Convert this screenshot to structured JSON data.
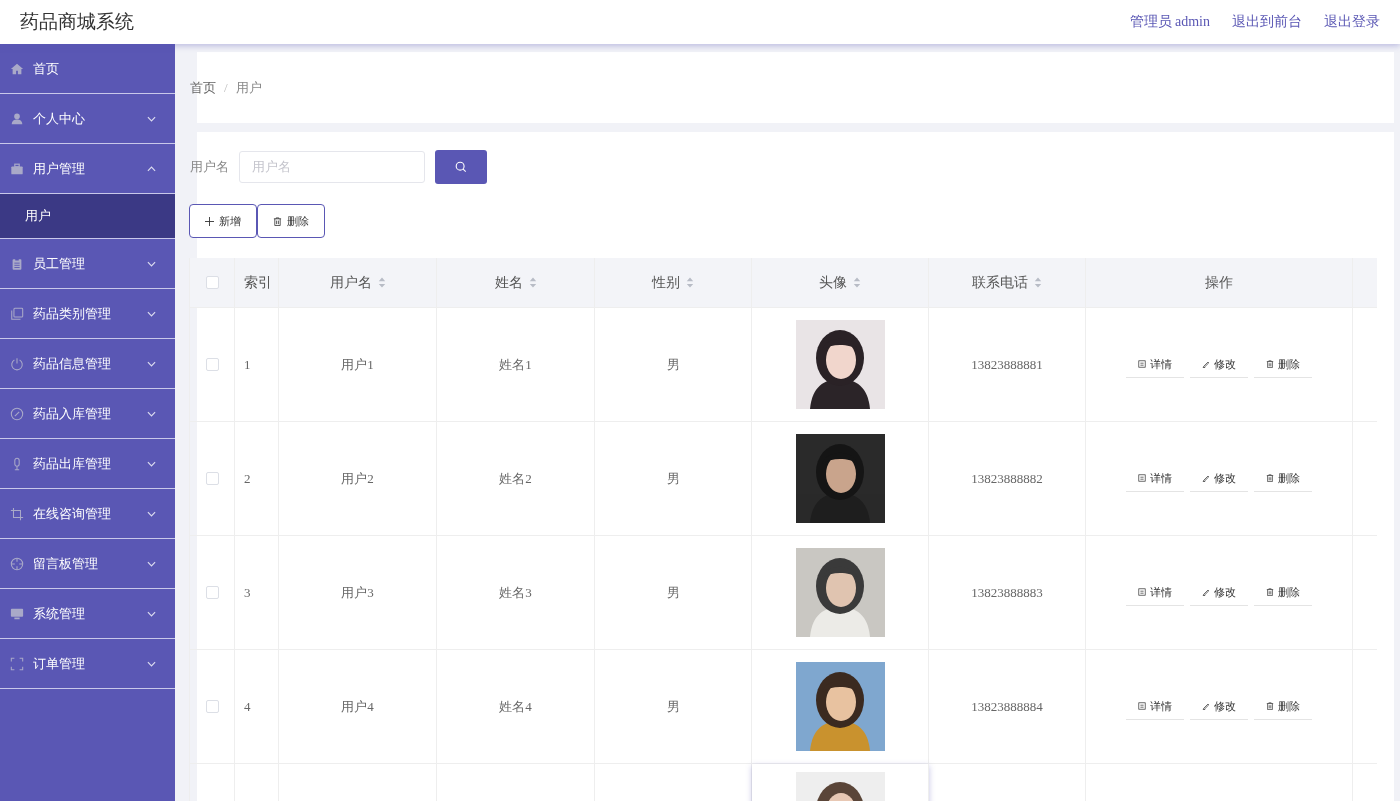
{
  "header": {
    "title": "药品商城系统",
    "links": [
      "管理员 admin",
      "退出到前台",
      "退出登录"
    ]
  },
  "sidebar": {
    "items": [
      {
        "label": "首页"
      },
      {
        "label": "个人中心",
        "expanded": false
      },
      {
        "label": "用户管理",
        "expanded": true,
        "children": [
          {
            "label": "用户",
            "selected": true
          }
        ]
      },
      {
        "label": "员工管理",
        "expanded": false
      },
      {
        "label": "药品类别管理",
        "expanded": false
      },
      {
        "label": "药品信息管理",
        "expanded": false
      },
      {
        "label": "药品入库管理",
        "expanded": false
      },
      {
        "label": "药品出库管理",
        "expanded": false
      },
      {
        "label": "在线咨询管理",
        "expanded": false
      },
      {
        "label": "留言板管理",
        "expanded": false
      },
      {
        "label": "系统管理",
        "expanded": false
      },
      {
        "label": "订单管理",
        "expanded": false
      }
    ]
  },
  "breadcrumb": [
    "首页",
    "/",
    "用户"
  ],
  "search": {
    "label": "用户名",
    "placeholder": "用户名"
  },
  "actions": [
    {
      "kind": "add",
      "label": "新增"
    },
    {
      "kind": "delete",
      "label": "删除"
    }
  ],
  "table": {
    "header_checked": false,
    "columns": [
      {
        "label": "索引",
        "sortable": false
      },
      {
        "label": "用户名",
        "sortable": true
      },
      {
        "label": "姓名",
        "sortable": true
      },
      {
        "label": "性别",
        "sortable": true
      },
      {
        "label": "头像",
        "sortable": true
      },
      {
        "label": "联系电话",
        "sortable": true
      },
      {
        "label": "操作",
        "sortable": false
      }
    ],
    "rows": [
      {
        "checked": false,
        "index": "1",
        "username": "用户1",
        "name": "姓名1",
        "gender": "男",
        "avatar": {
          "kind": "picture"
        },
        "phone": "13823888881",
        "ops": [
          "详情",
          "修改",
          "删除"
        ]
      },
      {
        "checked": false,
        "index": "2",
        "username": "用户2",
        "name": "姓名2",
        "gender": "男",
        "avatar": {
          "kind": "picture"
        },
        "phone": "13823888882",
        "ops": [
          "详情",
          "修改",
          "删除"
        ]
      },
      {
        "checked": false,
        "index": "3",
        "username": "用户3",
        "name": "姓名3",
        "gender": "男",
        "avatar": {
          "kind": "picture"
        },
        "phone": "13823888883",
        "ops": [
          "详情",
          "修改",
          "删除"
        ]
      },
      {
        "checked": false,
        "index": "4",
        "username": "用户4",
        "name": "姓名4",
        "gender": "男",
        "avatar": {
          "kind": "picture"
        },
        "phone": "13823888884",
        "ops": [
          "详情",
          "修改",
          "删除"
        ]
      }
    ]
  }
}
